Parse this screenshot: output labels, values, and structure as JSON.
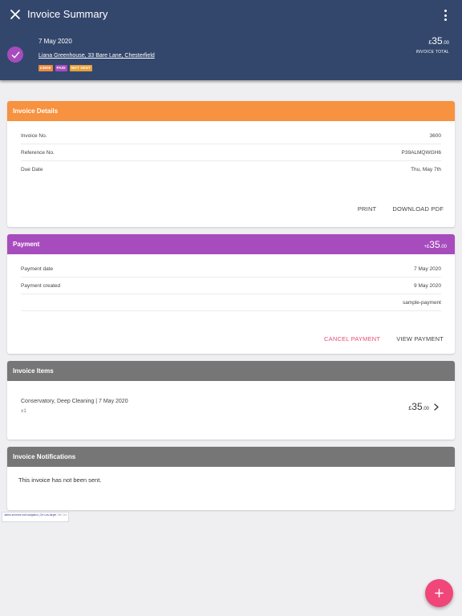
{
  "header": {
    "title": "Invoice Summary",
    "date": "7 May 2020",
    "address": "Liana Greenhouse, 33 Bare Lane, Chesterfield",
    "badges": [
      "£3600",
      "PAID",
      "NOT SENT"
    ],
    "total": {
      "currency": "£",
      "major": "35",
      "minor": ".00",
      "label": "INVOICE TOTAL"
    }
  },
  "invoice_details": {
    "title": "Invoice Details",
    "rows": [
      {
        "label": "Invoice No.",
        "value": "3600"
      },
      {
        "label": "Reference No.",
        "value": "P39ALMQWGH6"
      },
      {
        "label": "Due Date",
        "value": "Thu, May 7th"
      }
    ],
    "actions": {
      "print": "PRINT",
      "download": "DOWNLOAD PDF"
    }
  },
  "payment": {
    "title": "Payment",
    "amount": {
      "prefix": "+£",
      "major": "35",
      "minor": ".00"
    },
    "rows": [
      {
        "label": "Payment date",
        "value": "7 May 2020"
      },
      {
        "label": "Payment created",
        "value": "9 May 2020"
      },
      {
        "label": "",
        "value": "sample-payment"
      }
    ],
    "actions": {
      "cancel": "CANCEL PAYMENT",
      "view": "VIEW PAYMENT"
    }
  },
  "invoice_items": {
    "title": "Invoice Items",
    "item": {
      "description": "Conservatory, Deep Cleaning | 7 May 2020",
      "quantity": "x1",
      "price": {
        "currency": "£",
        "major": "35",
        "minor": ".00"
      }
    }
  },
  "invoice_notifications": {
    "title": "Invoice Notifications",
    "message": "This invoice has not been sent."
  },
  "debug_chip": {
    "text": "uktest-services.mdl.navigation_Ge h-as-target",
    "time": "19th Oct"
  },
  "colors": {
    "header_bg": "#33476d",
    "details_head": "#f79240",
    "payment_head": "#a74cbd",
    "gray_head": "#767676",
    "fab": "#f0467a",
    "pink_action": "#e84c76"
  }
}
